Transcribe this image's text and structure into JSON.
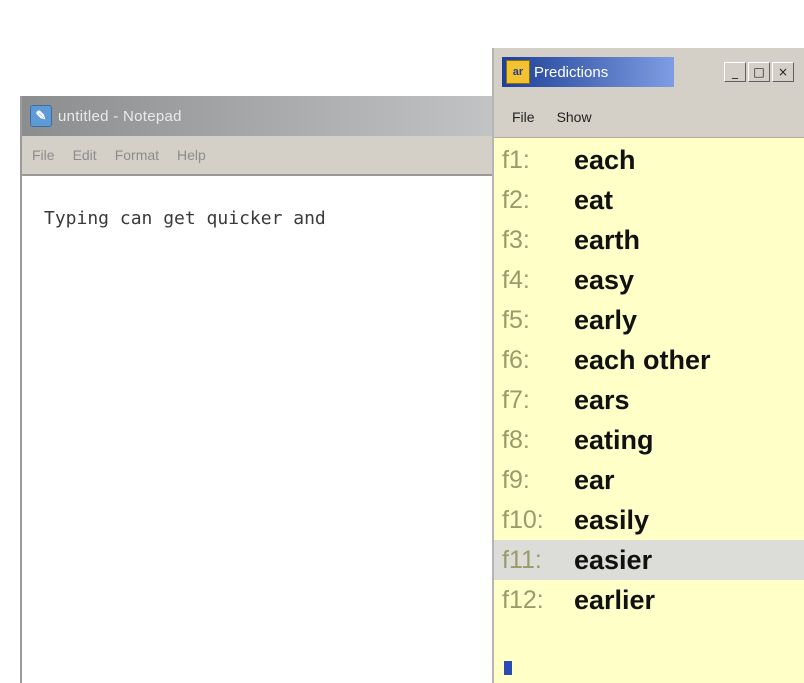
{
  "notepad": {
    "title": "untitled - Notepad",
    "menu": [
      "File",
      "Edit",
      "Format",
      "Help"
    ],
    "text": "Typing can get quicker and"
  },
  "predictor": {
    "title": "Predictions",
    "menu": [
      "File",
      "Show"
    ],
    "window_buttons": [
      "_",
      "□",
      "×"
    ],
    "items": [
      {
        "key": "f1:",
        "word": "each"
      },
      {
        "key": "f2:",
        "word": "eat"
      },
      {
        "key": "f3:",
        "word": "earth"
      },
      {
        "key": "f4:",
        "word": "easy"
      },
      {
        "key": "f5:",
        "word": "early"
      },
      {
        "key": "f6:",
        "word": "each other"
      },
      {
        "key": "f7:",
        "word": "ears"
      },
      {
        "key": "f8:",
        "word": "eating"
      },
      {
        "key": "f9:",
        "word": "ear"
      },
      {
        "key": "f10:",
        "word": "easily"
      },
      {
        "key": "f11:",
        "word": "easier"
      },
      {
        "key": "f12:",
        "word": "earlier"
      }
    ],
    "selected_index": 10
  },
  "colors": {
    "list_background": "#ffffc8",
    "selected_row": "#dcdcd8",
    "title_gradient_start": "#1d3f96"
  }
}
